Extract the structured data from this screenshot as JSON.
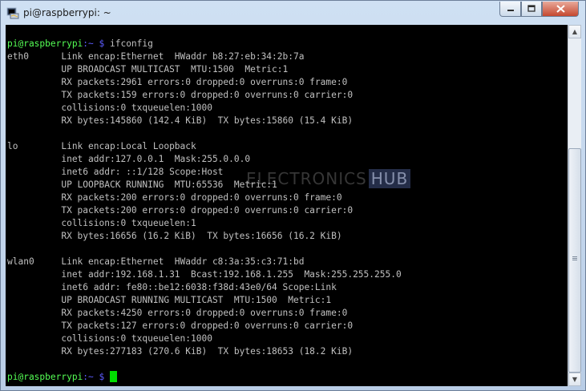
{
  "window": {
    "title": "pi@raspberrypi: ~",
    "icon": "putty-terminal-icon",
    "controls": {
      "minimize": "minimize-icon",
      "maximize": "maximize-icon",
      "close": "close-icon"
    }
  },
  "terminal": {
    "prompt_user": "pi@raspberrypi",
    "prompt_path": ":~ $",
    "command": " ifconfig",
    "lines": [
      "eth0      Link encap:Ethernet  HWaddr b8:27:eb:34:2b:7a",
      "          UP BROADCAST MULTICAST  MTU:1500  Metric:1",
      "          RX packets:2961 errors:0 dropped:0 overruns:0 frame:0",
      "          TX packets:159 errors:0 dropped:0 overruns:0 carrier:0",
      "          collisions:0 txqueuelen:1000",
      "          RX bytes:145860 (142.4 KiB)  TX bytes:15860 (15.4 KiB)",
      "",
      "lo        Link encap:Local Loopback",
      "          inet addr:127.0.0.1  Mask:255.0.0.0",
      "          inet6 addr: ::1/128 Scope:Host",
      "          UP LOOPBACK RUNNING  MTU:65536  Metric:1",
      "          RX packets:200 errors:0 dropped:0 overruns:0 frame:0",
      "          TX packets:200 errors:0 dropped:0 overruns:0 carrier:0",
      "          collisions:0 txqueuelen:1",
      "          RX bytes:16656 (16.2 KiB)  TX bytes:16656 (16.2 KiB)",
      "",
      "wlan0     Link encap:Ethernet  HWaddr c8:3a:35:c3:71:bd",
      "          inet addr:192.168.1.31  Bcast:192.168.1.255  Mask:255.255.255.0",
      "          inet6 addr: fe80::be12:6038:f38d:43e0/64 Scope:Link",
      "          UP BROADCAST RUNNING MULTICAST  MTU:1500  Metric:1",
      "          RX packets:4250 errors:0 dropped:0 overruns:0 frame:0",
      "          TX packets:127 errors:0 dropped:0 overruns:0 carrier:0",
      "          collisions:0 txqueuelen:1000",
      "          RX bytes:277183 (270.6 KiB)  TX bytes:18653 (18.2 KiB)",
      ""
    ],
    "final_prompt_user": "pi@raspberrypi",
    "final_prompt_path": ":~ $"
  },
  "watermark": {
    "text": "ELECTRONICS",
    "badge": "HUB"
  },
  "colors": {
    "prompt_user": "#55ff55",
    "prompt_path": "#5c5cff",
    "text": "#c0c0c0",
    "background": "#000000",
    "cursor": "#00dd00"
  }
}
